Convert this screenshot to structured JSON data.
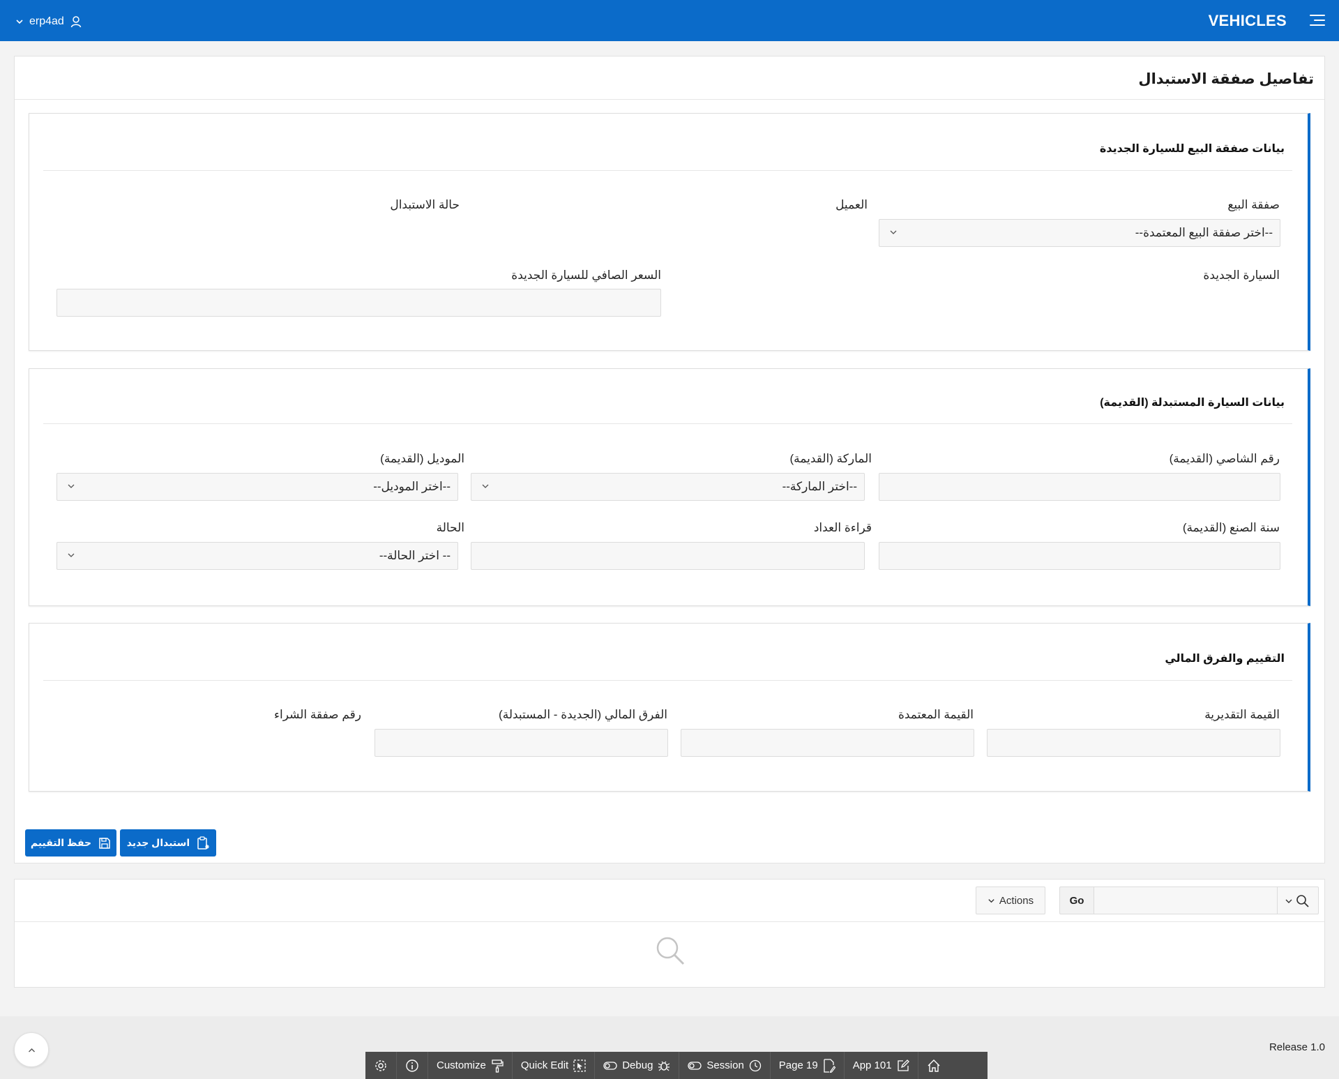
{
  "header": {
    "username": "erp4ad",
    "app_title": "VEHICLES"
  },
  "page": {
    "title": "تفاصيل صفقة الاستبدال"
  },
  "section_sale": {
    "title": "بيانات صفقة البيع للسيارة الجديدة",
    "sale_deal_label": "صفقة البيع",
    "sale_deal_value": "--اختر صفقة البيع المعتمدة--",
    "customer_label": "العميل",
    "exchange_status_label": "حالة الاستبدال",
    "new_car_label": "السيارة الجديدة",
    "net_price_label": "السعر الصافي للسيارة الجديدة"
  },
  "section_old_car": {
    "title": "بيانات السيارة المستبدلة (القديمة)",
    "chassis_label": "رقم الشاصي (القديمة)",
    "brand_label": "الماركة (القديمة)",
    "brand_value": "--اختر الماركة--",
    "model_label": "الموديل (القديمة)",
    "model_value": "--اختر الموديل--",
    "year_label": "سنة الصنع (القديمة)",
    "odometer_label": "قراءة العداد",
    "condition_label": "الحالة",
    "condition_value": "-- اختر الحالة--"
  },
  "section_valuation": {
    "title": "التقييم والفرق المالي",
    "estimated_label": "القيمة التقديرية",
    "approved_label": "القيمة المعتمدة",
    "difference_label": "الفرق المالي (الجديدة - المستبدلة)",
    "purchase_deal_label": "رقم صفقة الشراء"
  },
  "buttons": {
    "new_exchange": "استبدال جديد",
    "save_valuation": "حفظ التقييم"
  },
  "report": {
    "actions_label": "Actions",
    "go_label": "Go"
  },
  "footer": {
    "release": "Release 1.0"
  },
  "devbar": {
    "customize": "Customize",
    "quick_edit": "Quick Edit",
    "debug": "Debug",
    "session": "Session",
    "page": "Page 19",
    "app": "App 101"
  },
  "colors": {
    "accent": "#0b6bc9",
    "devbar": "#4a4a4a"
  }
}
